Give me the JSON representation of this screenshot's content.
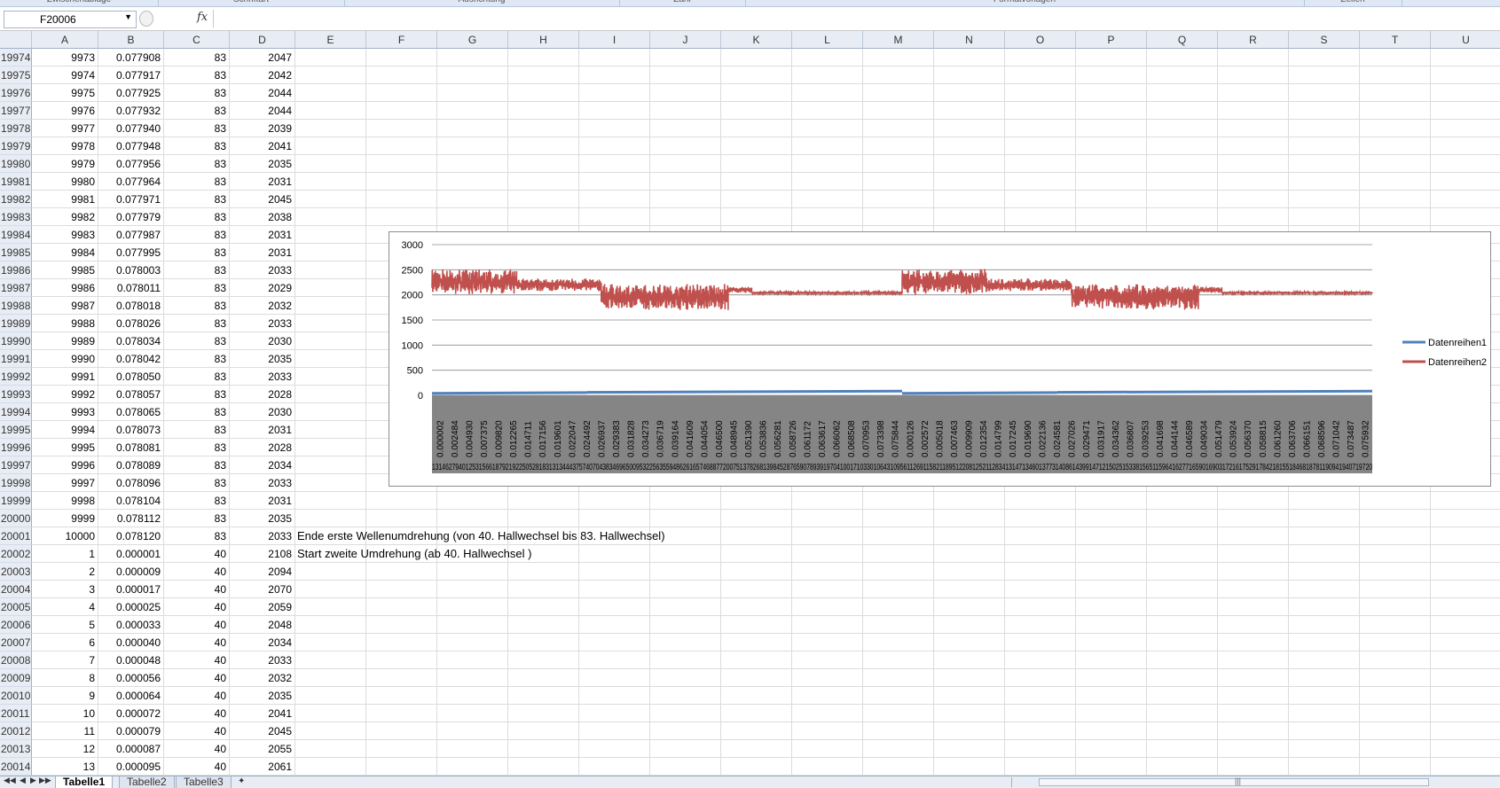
{
  "ribbon": {
    "groups": [
      {
        "label": "Zwischenablage",
        "x": 0,
        "w": 178
      },
      {
        "label": "Schriftart",
        "x": 178,
        "w": 210
      },
      {
        "label": "Ausrichtung",
        "x": 388,
        "w": 310
      },
      {
        "label": "Zahl",
        "x": 698,
        "w": 142
      },
      {
        "label": "Formatvorlagen",
        "x": 840,
        "w": 630
      },
      {
        "label": "Zellen",
        "x": 1470,
        "w": 110
      }
    ]
  },
  "formula_bar": {
    "name_box": "F20006",
    "fx_label": "fx",
    "formula": ""
  },
  "columns": [
    "A",
    "B",
    "C",
    "D",
    "E",
    "F",
    "G",
    "H",
    "I",
    "J",
    "K",
    "L",
    "M",
    "N",
    "O",
    "P",
    "Q",
    "R",
    "S",
    "T",
    "U"
  ],
  "rows": [
    {
      "n": "19974",
      "a": "9973",
      "b": "0.077908",
      "c": "83",
      "d": "2047"
    },
    {
      "n": "19975",
      "a": "9974",
      "b": "0.077917",
      "c": "83",
      "d": "2042"
    },
    {
      "n": "19976",
      "a": "9975",
      "b": "0.077925",
      "c": "83",
      "d": "2044"
    },
    {
      "n": "19977",
      "a": "9976",
      "b": "0.077932",
      "c": "83",
      "d": "2044"
    },
    {
      "n": "19978",
      "a": "9977",
      "b": "0.077940",
      "c": "83",
      "d": "2039"
    },
    {
      "n": "19979",
      "a": "9978",
      "b": "0.077948",
      "c": "83",
      "d": "2041"
    },
    {
      "n": "19980",
      "a": "9979",
      "b": "0.077956",
      "c": "83",
      "d": "2035"
    },
    {
      "n": "19981",
      "a": "9980",
      "b": "0.077964",
      "c": "83",
      "d": "2031"
    },
    {
      "n": "19982",
      "a": "9981",
      "b": "0.077971",
      "c": "83",
      "d": "2045"
    },
    {
      "n": "19983",
      "a": "9982",
      "b": "0.077979",
      "c": "83",
      "d": "2038"
    },
    {
      "n": "19984",
      "a": "9983",
      "b": "0.077987",
      "c": "83",
      "d": "2031"
    },
    {
      "n": "19985",
      "a": "9984",
      "b": "0.077995",
      "c": "83",
      "d": "2031"
    },
    {
      "n": "19986",
      "a": "9985",
      "b": "0.078003",
      "c": "83",
      "d": "2033"
    },
    {
      "n": "19987",
      "a": "9986",
      "b": "0.078011",
      "c": "83",
      "d": "2029"
    },
    {
      "n": "19988",
      "a": "9987",
      "b": "0.078018",
      "c": "83",
      "d": "2032"
    },
    {
      "n": "19989",
      "a": "9988",
      "b": "0.078026",
      "c": "83",
      "d": "2033"
    },
    {
      "n": "19990",
      "a": "9989",
      "b": "0.078034",
      "c": "83",
      "d": "2030"
    },
    {
      "n": "19991",
      "a": "9990",
      "b": "0.078042",
      "c": "83",
      "d": "2035"
    },
    {
      "n": "19992",
      "a": "9991",
      "b": "0.078050",
      "c": "83",
      "d": "2033"
    },
    {
      "n": "19993",
      "a": "9992",
      "b": "0.078057",
      "c": "83",
      "d": "2028"
    },
    {
      "n": "19994",
      "a": "9993",
      "b": "0.078065",
      "c": "83",
      "d": "2030"
    },
    {
      "n": "19995",
      "a": "9994",
      "b": "0.078073",
      "c": "83",
      "d": "2031"
    },
    {
      "n": "19996",
      "a": "9995",
      "b": "0.078081",
      "c": "83",
      "d": "2028"
    },
    {
      "n": "19997",
      "a": "9996",
      "b": "0.078089",
      "c": "83",
      "d": "2034"
    },
    {
      "n": "19998",
      "a": "9997",
      "b": "0.078096",
      "c": "83",
      "d": "2033"
    },
    {
      "n": "19999",
      "a": "9998",
      "b": "0.078104",
      "c": "83",
      "d": "2031"
    },
    {
      "n": "20000",
      "a": "9999",
      "b": "0.078112",
      "c": "83",
      "d": "2035"
    },
    {
      "n": "20001",
      "a": "10000",
      "b": "0.078120",
      "c": "83",
      "d": "2033"
    },
    {
      "n": "20002",
      "a": "1",
      "b": "0.000001",
      "c": "40",
      "d": "2108"
    },
    {
      "n": "20003",
      "a": "2",
      "b": "0.000009",
      "c": "40",
      "d": "2094"
    },
    {
      "n": "20004",
      "a": "3",
      "b": "0.000017",
      "c": "40",
      "d": "2070"
    },
    {
      "n": "20005",
      "a": "4",
      "b": "0.000025",
      "c": "40",
      "d": "2059"
    },
    {
      "n": "20006",
      "a": "5",
      "b": "0.000033",
      "c": "40",
      "d": "2048"
    },
    {
      "n": "20007",
      "a": "6",
      "b": "0.000040",
      "c": "40",
      "d": "2034"
    },
    {
      "n": "20008",
      "a": "7",
      "b": "0.000048",
      "c": "40",
      "d": "2033"
    },
    {
      "n": "20009",
      "a": "8",
      "b": "0.000056",
      "c": "40",
      "d": "2032"
    },
    {
      "n": "20010",
      "a": "9",
      "b": "0.000064",
      "c": "40",
      "d": "2035"
    },
    {
      "n": "20011",
      "a": "10",
      "b": "0.000072",
      "c": "40",
      "d": "2041"
    },
    {
      "n": "20012",
      "a": "11",
      "b": "0.000079",
      "c": "40",
      "d": "2045"
    },
    {
      "n": "20013",
      "a": "12",
      "b": "0.000087",
      "c": "40",
      "d": "2055"
    },
    {
      "n": "20014",
      "a": "13",
      "b": "0.000095",
      "c": "40",
      "d": "2061"
    }
  ],
  "notes": {
    "line1": "Ende erste Wellenumdrehung (von 40. Hallwechsel bis 83. Hallwechsel)",
    "line2": "Start zweite Umdrehung (ab 40. Hallwechsel )"
  },
  "chart_data": {
    "type": "line",
    "ylim": [
      0,
      3000
    ],
    "yticks": [
      0,
      500,
      1000,
      1500,
      2000,
      2500,
      3000
    ],
    "grid": true,
    "legend_position": "right",
    "x_tick_labels": [
      "0.000002",
      "0.002484",
      "0.004930",
      "0.007375",
      "0.009820",
      "0.012265",
      "0.014711",
      "0.017156",
      "0.019601",
      "0.022047",
      "0.024492",
      "0.026937",
      "0.029383",
      "0.031828",
      "0.034273",
      "0.036719",
      "0.039164",
      "0.041609",
      "0.044054",
      "0.046500",
      "0.048945",
      "0.051390",
      "0.053836",
      "0.056281",
      "0.058726",
      "0.061172",
      "0.063617",
      "0.066062",
      "0.068508",
      "0.070953",
      "0.073398",
      "0.075844",
      "0.000126",
      "0.002572",
      "0.005018",
      "0.007463",
      "0.009909",
      "0.012354",
      "0.014799",
      "0.017245",
      "0.019690",
      "0.022136",
      "0.024581",
      "0.027026",
      "0.029471",
      "0.031917",
      "0.034362",
      "0.036807",
      "0.039253",
      "0.041698",
      "0.044144",
      "0.046589",
      "0.049034",
      "0.051479",
      "0.053924",
      "0.056370",
      "0.058815",
      "0.061260",
      "0.063706",
      "0.066151",
      "0.068596",
      "0.071042",
      "0.073487",
      "0.075932"
    ],
    "x_points": 20000,
    "series": [
      {
        "name": "Datenreihen1",
        "color": "#4f81bd",
        "segments": [
          {
            "x_from": 0,
            "x_to": 3300,
            "y_from": 40,
            "y_to": 55
          },
          {
            "x_from": 3300,
            "x_to": 10000,
            "y_from": 60,
            "y_to": 83
          },
          {
            "x_from": 10000,
            "x_to": 13300,
            "y_from": 40,
            "y_to": 55
          },
          {
            "x_from": 13300,
            "x_to": 20000,
            "y_from": 60,
            "y_to": 83
          }
        ]
      },
      {
        "name": "Datenreihen2",
        "color": "#c0504d",
        "segments": [
          {
            "x_from": 0,
            "x_to": 1800,
            "center": 2260,
            "amplitude": 260
          },
          {
            "x_from": 1800,
            "x_to": 3600,
            "center": 2200,
            "amplitude": 130
          },
          {
            "x_from": 3600,
            "x_to": 6300,
            "center": 1960,
            "amplitude": 260
          },
          {
            "x_from": 6300,
            "x_to": 6800,
            "center": 2100,
            "amplitude": 60
          },
          {
            "x_from": 6800,
            "x_to": 10000,
            "center": 2040,
            "amplitude": 20
          },
          {
            "x_from": 10000,
            "x_to": 11800,
            "center": 2260,
            "amplitude": 260
          },
          {
            "x_from": 11800,
            "x_to": 13600,
            "center": 2200,
            "amplitude": 130
          },
          {
            "x_from": 13600,
            "x_to": 16300,
            "center": 1960,
            "amplitude": 260
          },
          {
            "x_from": 16300,
            "x_to": 16800,
            "center": 2100,
            "amplitude": 60
          },
          {
            "x_from": 16800,
            "x_to": 20000,
            "center": 2040,
            "amplitude": 20
          }
        ]
      }
    ]
  },
  "sheet_tabs": [
    "Tabelle1",
    "Tabelle2",
    "Tabelle3"
  ],
  "active_tab": "Tabelle1"
}
